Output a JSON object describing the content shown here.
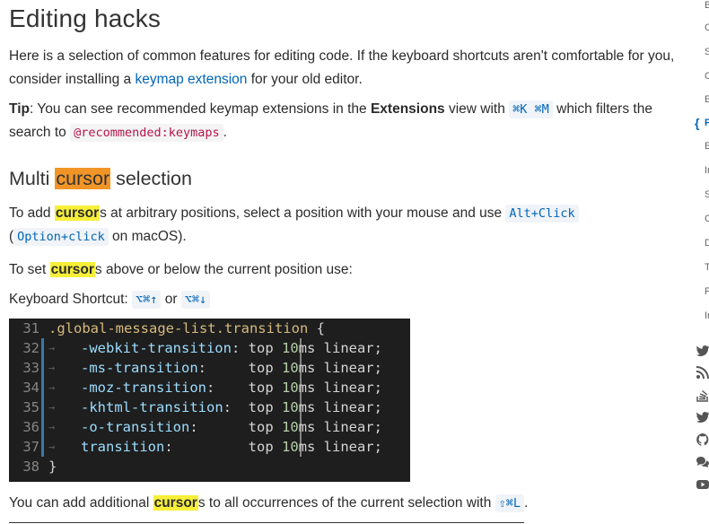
{
  "doc": {
    "title": "Editing hacks",
    "intro_before_link": "Here is a selection of common features for editing code. If the keyboard shortcuts aren't comfortable for you, consider installing a ",
    "intro_link": "keymap extension",
    "intro_after_link": " for your old editor.",
    "tip_label": "Tip",
    "tip_text_1": ": You can see recommended keymap extensions in the ",
    "tip_bold": "Extensions",
    "tip_text_2": " view with ",
    "tip_shortcut": "⌘K ⌘M",
    "tip_text_3": " which filters the search to ",
    "tip_filter": "@recommended:keymaps",
    "tip_text_4": ".",
    "section_title_1": "Multi ",
    "section_title_hl": "cursor",
    "section_title_2": " selection",
    "p3_1": "To add ",
    "p3_hl": "cursor",
    "p3_2": "s at arbitrary positions, select a position with your mouse and use ",
    "p3_kbd1": "Alt+Click",
    "p3_3": "(",
    "p3_kbd2": "Option+click",
    "p3_4": " on macOS).",
    "p4_1": "To set ",
    "p4_hl": "cursor",
    "p4_2": "s above or below the current position use:",
    "p5_1": "Keyboard Shortcut: ",
    "p5_kbd1": "⌥⌘↑",
    "p5_or": " or ",
    "p5_kbd2": "⌥⌘↓",
    "p6_1": "You can add additional ",
    "p6_hl": "cursor",
    "p6_2": "s to all occurrences of the current selection with ",
    "p6_kbd": "⇧⌘L",
    "p6_3": "."
  },
  "code_block": {
    "lines": [
      {
        "num": "31",
        "selector": ".global-message-list.transition",
        "brace": " {"
      },
      {
        "num": "32",
        "prop_a": "-webkit-",
        "prop_b": "transition",
        "colon": ":",
        "pad": " ",
        "val1": "top ",
        "num1": "10",
        "unit": "ms",
        "val2": " linear;"
      },
      {
        "num": "33",
        "prop_a": "-ms-",
        "prop_b": "transition",
        "colon": ":",
        "pad": "     ",
        "val1": "top ",
        "num1": "10",
        "unit": "ms",
        "val2": " linear;"
      },
      {
        "num": "34",
        "prop_a": "-moz-",
        "prop_b": "transition",
        "colon": ":",
        "pad": "    ",
        "val1": "top ",
        "num1": "10",
        "unit": "ms",
        "val2": " linear;"
      },
      {
        "num": "35",
        "prop_a": "-khtml-",
        "prop_b": "transition",
        "colon": ":",
        "pad": "  ",
        "val1": "top ",
        "num1": "10",
        "unit": "ms",
        "val2": " linear;"
      },
      {
        "num": "36",
        "prop_a": "-o-",
        "prop_b": "transition",
        "colon": ":",
        "pad": "      ",
        "val1": "top ",
        "num1": "10",
        "unit": "ms",
        "val2": " linear;"
      },
      {
        "num": "37",
        "prop_a": "",
        "prop_b": "transition",
        "colon": ":",
        "pad": "         ",
        "val1": "top ",
        "num1": "10",
        "unit": "ms",
        "val2": " linear;"
      },
      {
        "num": "38",
        "closing": "}"
      }
    ]
  },
  "sidebar": {
    "letters": [
      "B",
      "C",
      "S",
      "C",
      "E",
      "E",
      "Ir",
      "S",
      "C",
      "D",
      "T",
      "F",
      "Ir"
    ],
    "brace_letter": "{",
    "brace_tail": "F",
    "icons": [
      "twitter-icon",
      "rss-icon",
      "stackoverflow-icon",
      "twitter-icon",
      "github-icon",
      "chat-icon",
      "youtube-icon"
    ]
  },
  "colors": {
    "link": "#0066b8",
    "highlight_yellow": "#f7ef39",
    "highlight_orange": "#f29527",
    "code_bg": "#1e1e1e"
  }
}
